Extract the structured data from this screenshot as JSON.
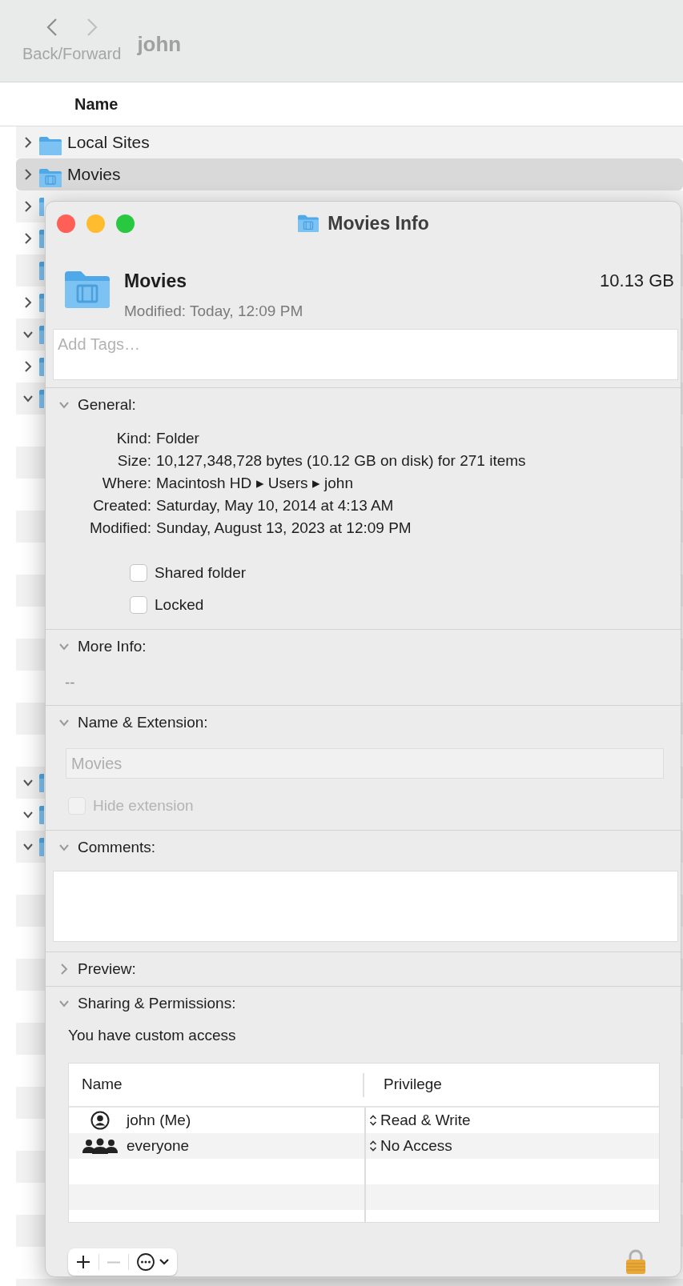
{
  "finder": {
    "nav_label": "Back/Forward",
    "folder_title": "john",
    "column": "Name",
    "rows": [
      {
        "kind": "folder",
        "label": "Local Sites",
        "expanded": false,
        "selected": false
      },
      {
        "kind": "movies",
        "label": "Movies",
        "expanded": false,
        "selected": true
      },
      {
        "kind": "folder",
        "expanded": false
      },
      {
        "kind": "folder",
        "expanded": false
      },
      {
        "kind": "folder"
      },
      {
        "kind": "folder",
        "expanded": false
      },
      {
        "kind": "folder",
        "expanded": true
      },
      {
        "kind": "folder",
        "expanded": false
      },
      {
        "kind": "folder",
        "expanded": true
      },
      {
        "kind": "blank"
      },
      {
        "kind": "blank"
      },
      {
        "kind": "blank"
      },
      {
        "kind": "blank"
      },
      {
        "kind": "blank"
      },
      {
        "kind": "blank"
      },
      {
        "kind": "blank"
      },
      {
        "kind": "blank"
      },
      {
        "kind": "blank"
      },
      {
        "kind": "blank"
      },
      {
        "kind": "blank"
      },
      {
        "kind": "folder",
        "expanded": true
      },
      {
        "kind": "folder",
        "expanded": true
      },
      {
        "kind": "folder",
        "expanded": true
      }
    ]
  },
  "info_window": {
    "title": "Movies Info",
    "name": "Movies",
    "modified": "Modified: Today, 12:09 PM",
    "size": "10.13 GB",
    "tags": {
      "placeholder": "Add Tags…"
    },
    "general": {
      "title": "General:",
      "expanded": true,
      "fields": [
        {
          "label": "Kind:",
          "value": "Folder"
        },
        {
          "label": "Size:",
          "value": "10,127,348,728 bytes (10.12 GB on disk) for 271 items"
        },
        {
          "label": "Where:",
          "value": "Macintosh HD ▸ Users ▸ john"
        },
        {
          "label": "Created:",
          "value": "Saturday, May 10, 2014 at 4:13 AM"
        },
        {
          "label": "Modified:",
          "value": "Sunday, August 13, 2023 at 12:09 PM"
        }
      ],
      "checkboxes": [
        {
          "label": "Shared folder",
          "checked": false
        },
        {
          "label": "Locked",
          "checked": false
        }
      ]
    },
    "more_info": {
      "title": "More Info:",
      "expanded": true,
      "value": "--"
    },
    "name_extension": {
      "title": "Name & Extension:",
      "expanded": true,
      "field": {
        "value": "Movies",
        "disabled": true
      },
      "hide_extension": {
        "label": "Hide extension",
        "checked": false,
        "disabled": true
      }
    },
    "comments": {
      "title": "Comments:",
      "expanded": true
    },
    "preview": {
      "title": "Preview:",
      "expanded": false
    },
    "sharing": {
      "title": "Sharing & Permissions:",
      "expanded": true,
      "note": "You have custom access",
      "columns": [
        "Name",
        "Privilege"
      ],
      "rows": [
        {
          "kind": "user",
          "name": "john (Me)",
          "privilege": "Read & Write"
        },
        {
          "kind": "group",
          "name": "everyone",
          "privilege": "No Access"
        }
      ],
      "remove_disabled": true
    }
  }
}
